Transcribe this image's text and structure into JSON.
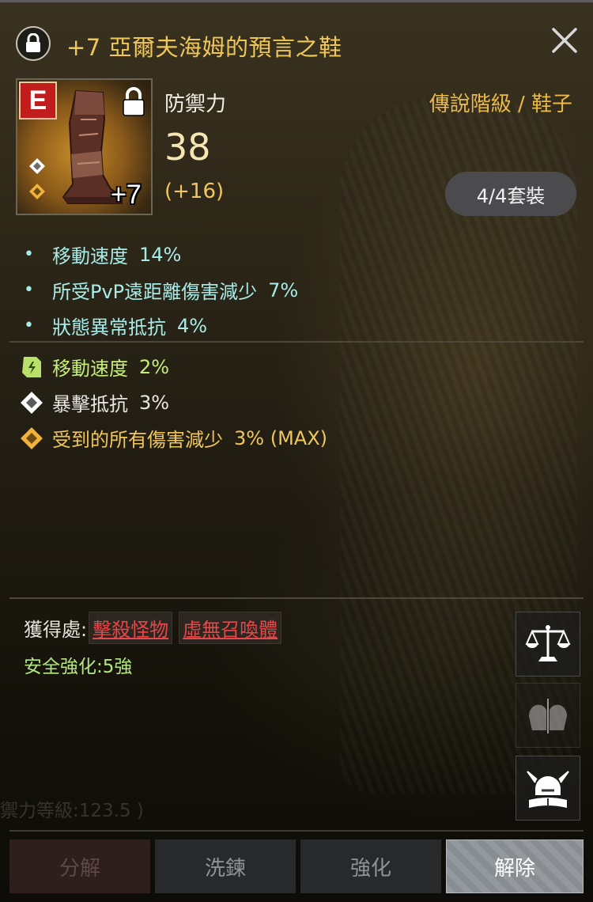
{
  "title": "+7 亞爾夫海姆的預言之鞋",
  "item": {
    "grade_letter": "E",
    "enhance_label": "+7",
    "stat_name": "防禦力",
    "stat_value": "38",
    "stat_bonus": "(+16)",
    "grade_type": "傳說階級 / 鞋子",
    "set_label": "4/4套裝"
  },
  "options": [
    {
      "name": "移動速度",
      "value": "14%"
    },
    {
      "name": "所受PvP遠距離傷害減少",
      "value": "7%"
    },
    {
      "name": "狀態異常抵抗",
      "value": "4%"
    }
  ],
  "special_options": [
    {
      "icon": "green-scroll-icon",
      "name": "移動速度",
      "value": "2%"
    },
    {
      "icon": "white-diamond-icon",
      "name": "暴擊抵抗",
      "value": "3%"
    },
    {
      "icon": "gold-diamond-icon",
      "name": "受到的所有傷害減少",
      "value": "3% (MAX)"
    }
  ],
  "source": {
    "label": "獲得處:",
    "tags": [
      "擊殺怪物",
      "虛無召喚體"
    ]
  },
  "safe_enhance": "安全強化:5強",
  "faded_text": "禦力等級:123.5 )",
  "side_buttons": [
    "scales-icon",
    "compare-helmets-icon",
    "viking-helmet-book-icon"
  ],
  "actions": {
    "disassemble": "分解",
    "refine": "洗鍊",
    "enhance": "強化",
    "release": "解除"
  },
  "colors": {
    "title_gold": "#f0c75a",
    "option_cyan": "#a7ece8",
    "special_green": "#c6ef79",
    "source_red": "#e44848",
    "safe_green": "#b4e680"
  }
}
